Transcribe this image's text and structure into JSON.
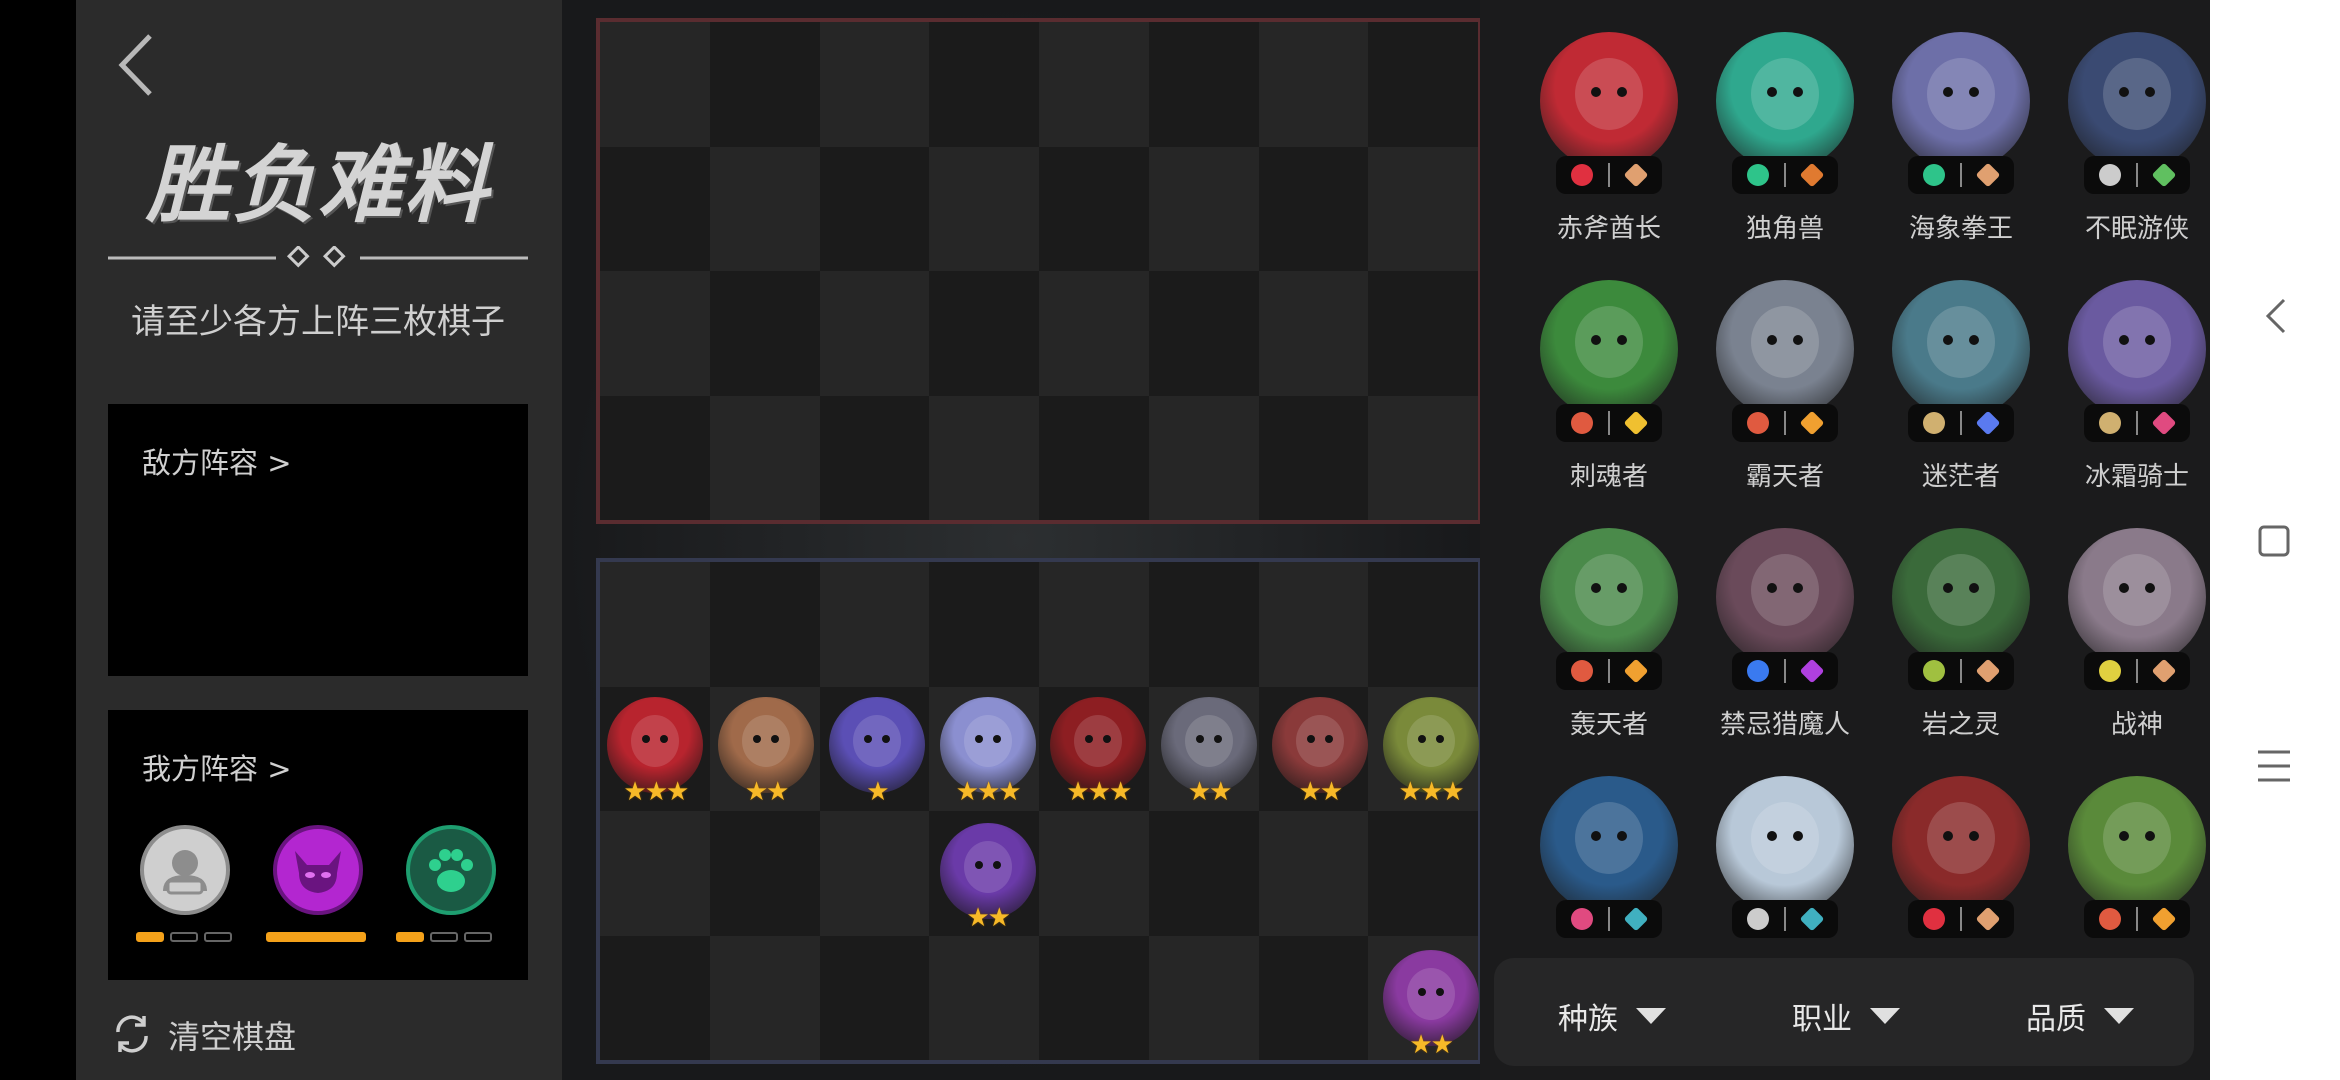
{
  "title": "胜负难料",
  "subtitle": "请至少各方上阵三枚棋子",
  "enemy_label": "敌方阵容 >",
  "ally_label": "我方阵容 >",
  "clear_label": "清空棋盘",
  "synergies": [
    {
      "icon": "knight-race-icon",
      "color": "#8d8d8d",
      "segments": 3,
      "active": 1
    },
    {
      "icon": "demon-icon",
      "color": "#b326d0",
      "segments": 1,
      "active": 1
    },
    {
      "icon": "beast-paw-icon",
      "color": "#1e9e70",
      "segments": 3,
      "active": 1
    }
  ],
  "pieces": [
    {
      "row": 1,
      "col": 0,
      "stars": "★★★",
      "color": "#b8242e",
      "icon": "red-beast-portrait"
    },
    {
      "row": 1,
      "col": 1,
      "stars": "★★",
      "color": "#a06a4a",
      "icon": "brawler-portrait"
    },
    {
      "row": 1,
      "col": 2,
      "stars": "★",
      "color": "#5b4fb5",
      "icon": "purple-ogre-portrait"
    },
    {
      "row": 1,
      "col": 3,
      "stars": "★★★",
      "color": "#8b8fd0",
      "icon": "ghost-portrait"
    },
    {
      "row": 1,
      "col": 4,
      "stars": "★★★",
      "color": "#8d1e22",
      "icon": "hooded-skull-portrait"
    },
    {
      "row": 1,
      "col": 5,
      "stars": "★★",
      "color": "#6a6a7a",
      "icon": "assassin-portrait"
    },
    {
      "row": 1,
      "col": 6,
      "stars": "★★",
      "color": "#8a3a3a",
      "icon": "dwarf-portrait"
    },
    {
      "row": 1,
      "col": 7,
      "stars": "★★★",
      "color": "#7a8a3a",
      "icon": "elder-portrait"
    },
    {
      "row": 2,
      "col": 3,
      "stars": "★★",
      "color": "#6a3aa8",
      "icon": "purple-hooded-portrait"
    },
    {
      "row": 3,
      "col": 7,
      "stars": "★★",
      "color": "#8a3aa0",
      "icon": "masked-portrait"
    }
  ],
  "heroes": [
    {
      "name": "赤斧酋长",
      "color": "#c02a34",
      "tag1": "#e03040",
      "tag2": "#e0a070"
    },
    {
      "name": "独角兽",
      "color": "#2fa88e",
      "tag1": "#2ec48a",
      "tag2": "#e07a30"
    },
    {
      "name": "海象拳王",
      "color": "#6d6fa8",
      "tag1": "#2ec48a",
      "tag2": "#e0a070"
    },
    {
      "name": "不眠游侠",
      "color": "#3a4a72",
      "tag1": "#cccccc",
      "tag2": "#60c060"
    },
    {
      "name": "刺魂者",
      "color": "#3c8a3c",
      "tag1": "#e05a40",
      "tag2": "#f0c030"
    },
    {
      "name": "霸天者",
      "color": "#7a8290",
      "tag1": "#e05a40",
      "tag2": "#f0a030"
    },
    {
      "name": "迷茫者",
      "color": "#4a7a8a",
      "tag1": "#d0b070",
      "tag2": "#5a7af0"
    },
    {
      "name": "冰霜骑士",
      "color": "#6a5aa0",
      "tag1": "#d0b070",
      "tag2": "#e04a80"
    },
    {
      "name": "轰天者",
      "color": "#4a8a4a",
      "tag1": "#e05a40",
      "tag2": "#f0a030"
    },
    {
      "name": "禁忌猎魔人",
      "color": "#6a4a5a",
      "tag1": "#3a7af0",
      "tag2": "#b040e0"
    },
    {
      "name": "岩之灵",
      "color": "#3a6a3a",
      "tag1": "#a0c040",
      "tag2": "#e0a070"
    },
    {
      "name": "战神",
      "color": "#8a7a8a",
      "tag1": "#e0d040",
      "tag2": "#e0a070"
    },
    {
      "name": "",
      "color": "#2a5a8a",
      "tag1": "#e04a80",
      "tag2": "#40b0c0"
    },
    {
      "name": "",
      "color": "#b8c8d8",
      "tag1": "#cccccc",
      "tag2": "#40b0c0"
    },
    {
      "name": "",
      "color": "#8a2a2a",
      "tag1": "#e03040",
      "tag2": "#e0a070"
    },
    {
      "name": "",
      "color": "#5a8a3a",
      "tag1": "#e05a40",
      "tag2": "#f0a030"
    }
  ],
  "filters": [
    "种族",
    "职业",
    "品质"
  ]
}
